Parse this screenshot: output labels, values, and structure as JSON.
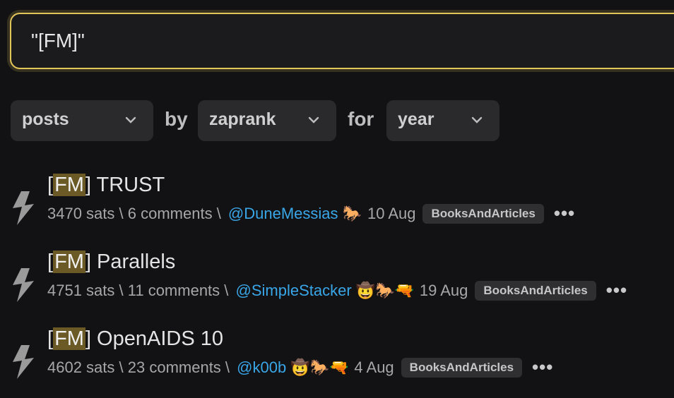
{
  "search": {
    "value": "\"[FM]\""
  },
  "filters": {
    "type_value": "posts",
    "by_word": "by",
    "sort_value": "zaprank",
    "for_word": "for",
    "time_value": "year"
  },
  "items": [
    {
      "title_prefix": "[",
      "title_highlight": "FM",
      "title_rest": "] TRUST",
      "sats": "3470 sats",
      "sep1": " \\ ",
      "comments": "6 comments",
      "sep2": " \\ ",
      "user": "@DuneMessias",
      "icons": "🐎",
      "date": "10 Aug",
      "badge": "BooksAndArticles",
      "more": "•••"
    },
    {
      "title_prefix": "[",
      "title_highlight": "FM",
      "title_rest": "] Parallels",
      "sats": "4751 sats",
      "sep1": " \\ ",
      "comments": "11 comments",
      "sep2": " \\ ",
      "user": "@SimpleStacker",
      "icons": "🤠🐎🔫",
      "date": "19 Aug",
      "badge": "BooksAndArticles",
      "more": "•••"
    },
    {
      "title_prefix": "[",
      "title_highlight": "FM",
      "title_rest": "] OpenAIDS 10",
      "sats": "4602 sats",
      "sep1": " \\ ",
      "comments": "23 comments",
      "sep2": " \\ ",
      "user": "@k00b",
      "icons": "🤠🐎🔫",
      "date": "4 Aug",
      "badge": "BooksAndArticles",
      "more": "•••"
    }
  ]
}
